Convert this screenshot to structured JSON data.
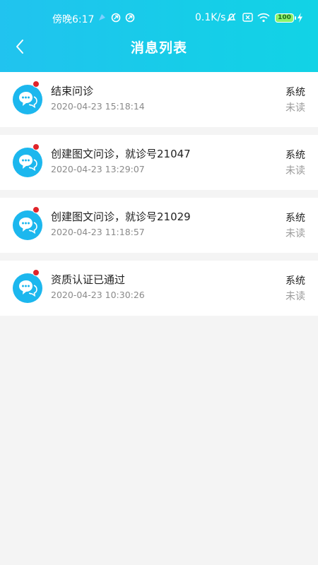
{
  "status_bar": {
    "time": "傍晚6:17",
    "net_speed": "0.1K/s",
    "battery_level": "100"
  },
  "nav": {
    "title": "消息列表"
  },
  "messages": [
    {
      "title": "结束问诊",
      "time": "2020-04-23 15:18:14",
      "source": "系统",
      "status": "未读"
    },
    {
      "title": "创建图文问诊，就诊号21047",
      "time": "2020-04-23 13:29:07",
      "source": "系统",
      "status": "未读"
    },
    {
      "title": "创建图文问诊，就诊号21029",
      "time": "2020-04-23 11:18:57",
      "source": "系统",
      "status": "未读"
    },
    {
      "title": "资质认证已通过",
      "time": "2020-04-23 10:30:26",
      "source": "系统",
      "status": "未读"
    }
  ],
  "colors": {
    "header_start": "#21c3ef",
    "header_end": "#12d3e6",
    "avatar": "#1cb7ee",
    "unread_dot": "#e0242a",
    "battery": "#8cf36a"
  }
}
